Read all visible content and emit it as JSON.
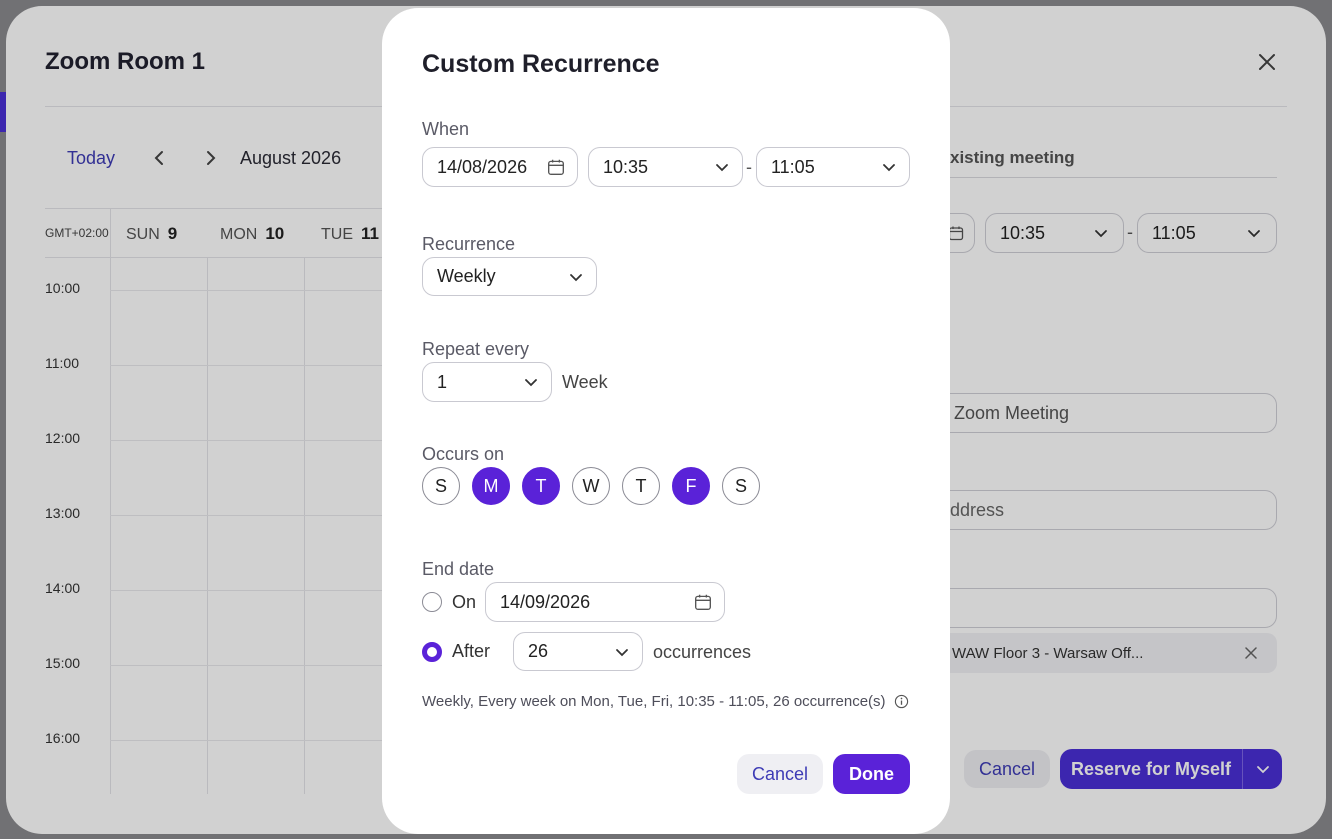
{
  "background": {
    "title": "Zoom Room 1",
    "today_label": "Today",
    "month_label": "August 2026",
    "timezone": "GMT+02:00",
    "days": [
      {
        "name": "SUN",
        "num": "9"
      },
      {
        "name": "MON",
        "num": "10"
      },
      {
        "name": "TUE",
        "num": "11"
      }
    ],
    "hours": [
      "10:00",
      "11:00",
      "12:00",
      "13:00",
      "14:00",
      "15:00",
      "16:00"
    ],
    "right_tab": "xisting meeting",
    "start_time": "10:35",
    "end_time": "11:05",
    "topic_value": "s Zoom Meeting",
    "email_placeholder": " address",
    "location_chip": "WAW Floor 3 - Warsaw Off...",
    "cancel_label": "Cancel",
    "reserve_label": "Reserve for Myself"
  },
  "modal": {
    "title": "Custom Recurrence",
    "when_label": "When",
    "date": "14/08/2026",
    "start_time": "10:35",
    "end_time": "11:05",
    "dash": "-",
    "recurrence_label": "Recurrence",
    "recurrence_value": "Weekly",
    "repeat_label": "Repeat every",
    "repeat_value": "1",
    "repeat_unit": "Week",
    "occurs_label": "Occurs on",
    "weekdays": [
      {
        "letter": "S",
        "selected": false
      },
      {
        "letter": "M",
        "selected": true
      },
      {
        "letter": "T",
        "selected": true
      },
      {
        "letter": "W",
        "selected": false
      },
      {
        "letter": "T",
        "selected": false
      },
      {
        "letter": "F",
        "selected": true
      },
      {
        "letter": "S",
        "selected": false
      }
    ],
    "end_label": "End date",
    "on_label": "On",
    "on_date": "14/09/2026",
    "after_label": "After",
    "after_value": "26",
    "occurrences_label": "occurrences",
    "selected_end_option": "After",
    "summary": "Weekly, Every week on Mon, Tue, Fri, 10:35 - 11:05, 26 occurrence(s)",
    "cancel_label": "Cancel",
    "done_label": "Done"
  },
  "colors": {
    "accent": "#5a22d8",
    "link": "#3d3bb5"
  }
}
